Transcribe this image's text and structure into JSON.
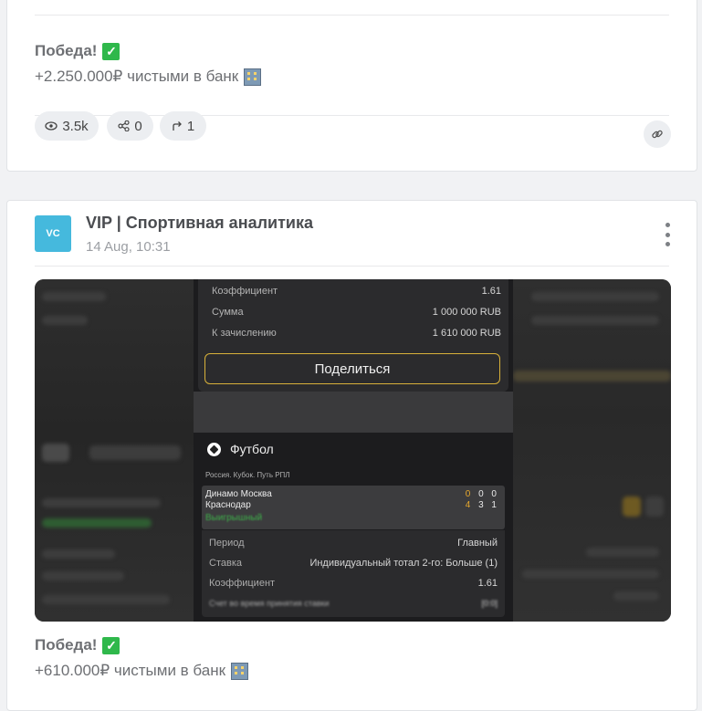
{
  "post1": {
    "result": "Победа!",
    "profit": "+2.250.000₽ чистыми в банк",
    "stats": {
      "views": "3.5k",
      "shares": "0",
      "forwards": "1"
    }
  },
  "post2": {
    "channel": {
      "avatar_text": "VC",
      "name": "VIP | Спортивная аналитика",
      "date": "14 Aug, 10:31"
    },
    "screenshot": {
      "coef_label": "Коэффициент",
      "coef_value": "1.61",
      "sum_label": "Сумма",
      "sum_value": "1 000 000 RUB",
      "credit_label": "К зачислению",
      "credit_value": "1 610 000 RUB",
      "share_button": "Поделиться",
      "sport": "Футбол",
      "league": "Россия. Кубок. Путь РПЛ",
      "team1": "Динамо Москва",
      "team1_score_a": "0",
      "team1_score_b": "0 0",
      "team2": "Краснодар",
      "team2_score_a": "4",
      "team2_score_b": "3 1",
      "status": "Выигрышный",
      "period_label": "Период",
      "period_value": "Главный",
      "bet_label": "Ставка",
      "bet_value": "Индивидуальный тотал 2-го: Больше (1)",
      "coef2_label": "Коэффициент",
      "coef2_value": "1.61",
      "score_label": "Счет во время принятия ставки",
      "score_value": "[0:0]"
    },
    "result": "Победа!",
    "profit": "+610.000₽ чистыми в банк"
  },
  "colors": {
    "avatar_bg": "#45b9dd",
    "check_green": "#2fb84b",
    "share_border": "#d8b13a",
    "won_green": "#3fae4a"
  }
}
